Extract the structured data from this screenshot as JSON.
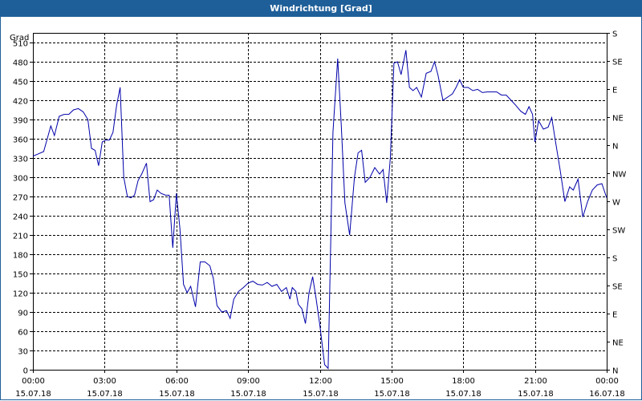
{
  "window": {
    "title": "Windrichtung [Grad]"
  },
  "colors": {
    "titlebar": "#1f5f99",
    "line": "#0000aa",
    "grid": "#000000"
  },
  "chart_data": {
    "type": "line",
    "title": "Windrichtung [Grad]",
    "ylabel": "Grad",
    "ylim": [
      0,
      525
    ],
    "grid": true,
    "y_ticks": [
      0,
      30,
      60,
      90,
      120,
      150,
      180,
      210,
      240,
      270,
      300,
      330,
      360,
      390,
      420,
      450,
      480,
      510
    ],
    "compass_ticks": [
      {
        "value": 0,
        "label": "N"
      },
      {
        "value": 45,
        "label": "NE"
      },
      {
        "value": 90,
        "label": "E"
      },
      {
        "value": 135,
        "label": "SE"
      },
      {
        "value": 180,
        "label": "S"
      },
      {
        "value": 225,
        "label": "SW"
      },
      {
        "value": 270,
        "label": "W"
      },
      {
        "value": 315,
        "label": "NW"
      },
      {
        "value": 360,
        "label": "N"
      },
      {
        "value": 405,
        "label": "NE"
      },
      {
        "value": 450,
        "label": "E"
      },
      {
        "value": 495,
        "label": "SE"
      },
      {
        "value": 540,
        "label": "S"
      }
    ],
    "x_range_hours": [
      0,
      24
    ],
    "x_ticks": [
      {
        "hour": 0,
        "time": "00:00",
        "date": "15.07.18"
      },
      {
        "hour": 3,
        "time": "03:00",
        "date": "15.07.18"
      },
      {
        "hour": 6,
        "time": "06:00",
        "date": "15.07.18"
      },
      {
        "hour": 9,
        "time": "09:00",
        "date": "15.07.18"
      },
      {
        "hour": 12,
        "time": "12:00",
        "date": "15.07.18"
      },
      {
        "hour": 15,
        "time": "15:00",
        "date": "15.07.18"
      },
      {
        "hour": 18,
        "time": "18:00",
        "date": "15.07.18"
      },
      {
        "hour": 21,
        "time": "21:00",
        "date": "15.07.18"
      },
      {
        "hour": 24,
        "time": "00:00",
        "date": "16.07.18"
      }
    ],
    "series": [
      {
        "points": [
          [
            0.0,
            333
          ],
          [
            0.2,
            336
          ],
          [
            0.45,
            340
          ],
          [
            0.6,
            360
          ],
          [
            0.75,
            380
          ],
          [
            0.9,
            365
          ],
          [
            1.1,
            395
          ],
          [
            1.3,
            398
          ],
          [
            1.5,
            398
          ],
          [
            1.7,
            405
          ],
          [
            1.9,
            407
          ],
          [
            2.1,
            402
          ],
          [
            2.3,
            390
          ],
          [
            2.45,
            345
          ],
          [
            2.6,
            342
          ],
          [
            2.75,
            318
          ],
          [
            2.9,
            355
          ],
          [
            3.05,
            358
          ],
          [
            3.2,
            358
          ],
          [
            3.35,
            370
          ],
          [
            3.5,
            412
          ],
          [
            3.65,
            440
          ],
          [
            3.8,
            300
          ],
          [
            3.95,
            270
          ],
          [
            4.1,
            268
          ],
          [
            4.25,
            272
          ],
          [
            4.4,
            295
          ],
          [
            4.55,
            305
          ],
          [
            4.75,
            322
          ],
          [
            4.9,
            262
          ],
          [
            5.05,
            265
          ],
          [
            5.2,
            280
          ],
          [
            5.35,
            275
          ],
          [
            5.55,
            272
          ],
          [
            5.7,
            272
          ],
          [
            5.85,
            190
          ],
          [
            6.0,
            275
          ],
          [
            6.15,
            220
          ],
          [
            6.3,
            133
          ],
          [
            6.45,
            120
          ],
          [
            6.6,
            130
          ],
          [
            6.8,
            98
          ],
          [
            7.0,
            168
          ],
          [
            7.2,
            168
          ],
          [
            7.4,
            162
          ],
          [
            7.55,
            142
          ],
          [
            7.7,
            100
          ],
          [
            7.9,
            90
          ],
          [
            8.1,
            92
          ],
          [
            8.25,
            80
          ],
          [
            8.4,
            110
          ],
          [
            8.6,
            122
          ],
          [
            8.8,
            128
          ],
          [
            9.0,
            135
          ],
          [
            9.2,
            138
          ],
          [
            9.4,
            133
          ],
          [
            9.6,
            132
          ],
          [
            9.8,
            136
          ],
          [
            10.0,
            130
          ],
          [
            10.2,
            133
          ],
          [
            10.4,
            122
          ],
          [
            10.6,
            128
          ],
          [
            10.75,
            110
          ],
          [
            10.85,
            128
          ],
          [
            11.0,
            122
          ],
          [
            11.1,
            102
          ],
          [
            11.25,
            95
          ],
          [
            11.4,
            72
          ],
          [
            11.55,
            120
          ],
          [
            11.7,
            145
          ],
          [
            11.85,
            110
          ],
          [
            12.0,
            70
          ],
          [
            12.2,
            8
          ],
          [
            12.35,
            2
          ],
          [
            12.55,
            370
          ],
          [
            12.75,
            485
          ],
          [
            12.9,
            380
          ],
          [
            13.05,
            260
          ],
          [
            13.25,
            210
          ],
          [
            13.45,
            300
          ],
          [
            13.6,
            338
          ],
          [
            13.75,
            342
          ],
          [
            13.9,
            292
          ],
          [
            14.1,
            300
          ],
          [
            14.3,
            315
          ],
          [
            14.5,
            305
          ],
          [
            14.65,
            312
          ],
          [
            14.8,
            260
          ],
          [
            14.95,
            330
          ],
          [
            15.1,
            478
          ],
          [
            15.25,
            480
          ],
          [
            15.4,
            460
          ],
          [
            15.6,
            498
          ],
          [
            15.75,
            440
          ],
          [
            15.9,
            435
          ],
          [
            16.05,
            440
          ],
          [
            16.25,
            425
          ],
          [
            16.45,
            462
          ],
          [
            16.65,
            465
          ],
          [
            16.8,
            480
          ],
          [
            16.95,
            458
          ],
          [
            17.15,
            420
          ],
          [
            17.35,
            425
          ],
          [
            17.55,
            430
          ],
          [
            17.7,
            440
          ],
          [
            17.85,
            452
          ],
          [
            18.0,
            440
          ],
          [
            18.2,
            440
          ],
          [
            18.4,
            435
          ],
          [
            18.6,
            437
          ],
          [
            18.8,
            432
          ],
          [
            19.0,
            433
          ],
          [
            19.2,
            433
          ],
          [
            19.4,
            433
          ],
          [
            19.6,
            428
          ],
          [
            19.8,
            428
          ],
          [
            20.0,
            420
          ],
          [
            20.2,
            412
          ],
          [
            20.4,
            403
          ],
          [
            20.6,
            398
          ],
          [
            20.75,
            410
          ],
          [
            20.9,
            398
          ],
          [
            21.0,
            355
          ],
          [
            21.15,
            388
          ],
          [
            21.35,
            375
          ],
          [
            21.55,
            378
          ],
          [
            21.7,
            393
          ],
          [
            21.85,
            358
          ],
          [
            22.05,
            312
          ],
          [
            22.25,
            262
          ],
          [
            22.45,
            285
          ],
          [
            22.6,
            280
          ],
          [
            22.8,
            297
          ],
          [
            23.0,
            238
          ],
          [
            23.2,
            262
          ],
          [
            23.4,
            280
          ],
          [
            23.6,
            288
          ],
          [
            23.8,
            290
          ],
          [
            24.0,
            268
          ]
        ]
      }
    ]
  }
}
